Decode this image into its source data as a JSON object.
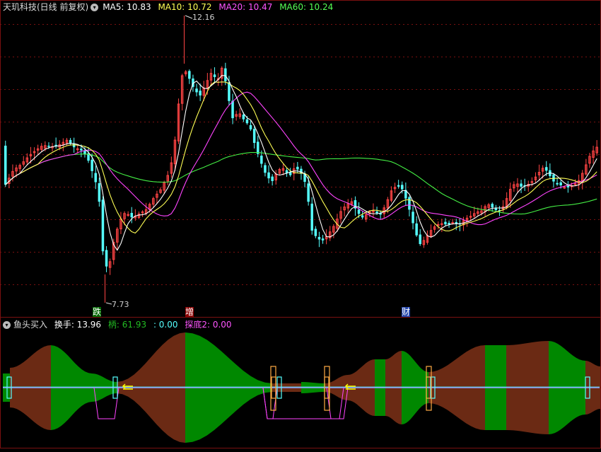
{
  "main": {
    "title": "天玑科技(日线 前复权)",
    "indicators": [
      {
        "label": "MA5: 10.83",
        "color": "#ffffff"
      },
      {
        "label": "MA10: 10.72",
        "color": "#ffff55"
      },
      {
        "label": "MA20: 10.47",
        "color": "#ff55ff"
      },
      {
        "label": "MA60: 10.24",
        "color": "#55ff55"
      }
    ],
    "high_label": "12.16",
    "low_label": "7.73",
    "events": [
      {
        "text": "跌",
        "color": "#ffffff",
        "bg": "#00aa00"
      },
      {
        "text": "增",
        "color": "#ffffff",
        "bg": "#aa0000"
      },
      {
        "text": "财",
        "color": "#ffffff",
        "bg": "#3355cc"
      }
    ]
  },
  "sub": {
    "title": "鱼头买入",
    "fields": [
      {
        "label": "换手: 13.96",
        "color": "#ffffff"
      },
      {
        "label": "柄: 61.93",
        "color": "#22bb22"
      },
      {
        "label": ": 0.00",
        "color": "#55ffff"
      },
      {
        "label": "探底2: 0.00",
        "color": "#ff55ff"
      }
    ]
  },
  "colors": {
    "up": "#ff4444",
    "down": "#55ffff",
    "ma5": "#ffffff",
    "ma10": "#ffff55",
    "ma20": "#ff44ff",
    "ma60": "#44ee44",
    "fill_green": "#008800",
    "fill_brown": "#6b2a14",
    "grid": "#7a1010"
  }
}
